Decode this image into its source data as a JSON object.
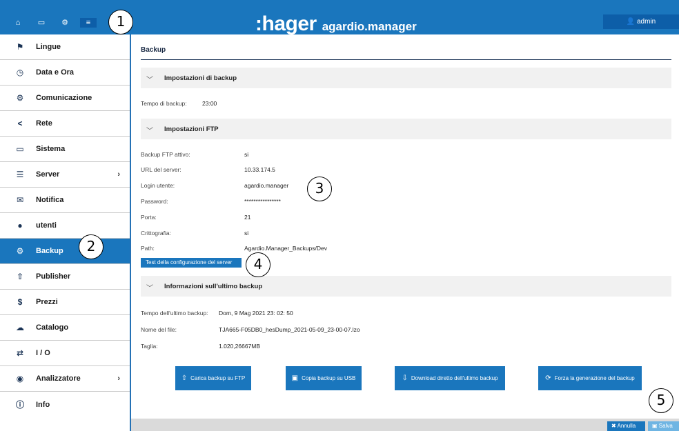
{
  "header": {
    "brand": "hager",
    "app_name": "agardio.manager",
    "user": "admin",
    "nav_icons": [
      "home-icon",
      "monitor-icon",
      "gears-icon",
      "sliders-icon"
    ]
  },
  "callouts": [
    "1",
    "2",
    "3",
    "4",
    "5"
  ],
  "sidebar": {
    "items": [
      {
        "label": "Lingue",
        "icon": "flag-icon",
        "glyph": "⚑"
      },
      {
        "label": "Data e Ora",
        "icon": "clock-icon",
        "glyph": "◷"
      },
      {
        "label": "Comunicazione",
        "icon": "gears-icon",
        "glyph": "⚙"
      },
      {
        "label": "Rete",
        "icon": "share-icon",
        "glyph": "<"
      },
      {
        "label": "Sistema",
        "icon": "drive-icon",
        "glyph": "▭"
      },
      {
        "label": "Server",
        "icon": "server-icon",
        "glyph": "☰"
      },
      {
        "label": "Notifica",
        "icon": "envelope-icon",
        "glyph": "✉"
      },
      {
        "label": "utenti",
        "icon": "users-icon",
        "glyph": "●"
      },
      {
        "label": "Backup",
        "icon": "gears-icon",
        "glyph": "⚙"
      },
      {
        "label": "Publisher",
        "icon": "upload-icon",
        "glyph": "⇧"
      },
      {
        "label": "Prezzi",
        "icon": "dollar-icon",
        "glyph": "$"
      },
      {
        "label": "Catalogo",
        "icon": "cloud-upload-icon",
        "glyph": "☁"
      },
      {
        "label": "I / O",
        "icon": "exchange-icon",
        "glyph": "⇄"
      },
      {
        "label": "Analizzatore",
        "icon": "eye-icon",
        "glyph": "◉"
      },
      {
        "label": "Info",
        "icon": "info-icon",
        "glyph": "ⓘ"
      }
    ],
    "chevron": "›"
  },
  "page": {
    "title": "Backup"
  },
  "backup_settings": {
    "title": "Impostazioni di backup",
    "time_label": "Tempo di backup:",
    "time_value": "23:00"
  },
  "ftp_settings": {
    "title": "Impostazioni FTP",
    "rows": [
      {
        "label": "Backup FTP attivo:",
        "value": "si"
      },
      {
        "label": "URL del server:",
        "value": "10.33.174.5"
      },
      {
        "label": "Login utente:",
        "value": "agardio.manager"
      },
      {
        "label": "Password:",
        "value": "****************"
      },
      {
        "label": "Porta:",
        "value": "21"
      },
      {
        "label": "Crittografia:",
        "value": "si"
      },
      {
        "label": "Path:",
        "value": "Agardio.Manager_Backups/Dev"
      }
    ],
    "test_button": "Test della configurazione del server"
  },
  "last_backup": {
    "title": "Informazioni sull'ultimo backup",
    "rows": [
      {
        "label": "Tempo dell'ultimo backup:",
        "value": "Dom, 9 Mag 2021 23: 02: 50"
      },
      {
        "label": "Nome del file:",
        "value": "TJA665-F05DB0_hesDump_2021-05-09_23-00-07.lzo"
      },
      {
        "label": "Taglia:",
        "value": "1.020,26667MB"
      }
    ]
  },
  "actions": {
    "upload_ftp": "Carica backup su FTP",
    "copy_usb": "Copia backup su USB",
    "download_last": "Download diretto dell'ultimo backup",
    "force_generate": "Forza la generazione del backup"
  },
  "footer": {
    "cancel": "Annulla",
    "save": "Salva"
  }
}
